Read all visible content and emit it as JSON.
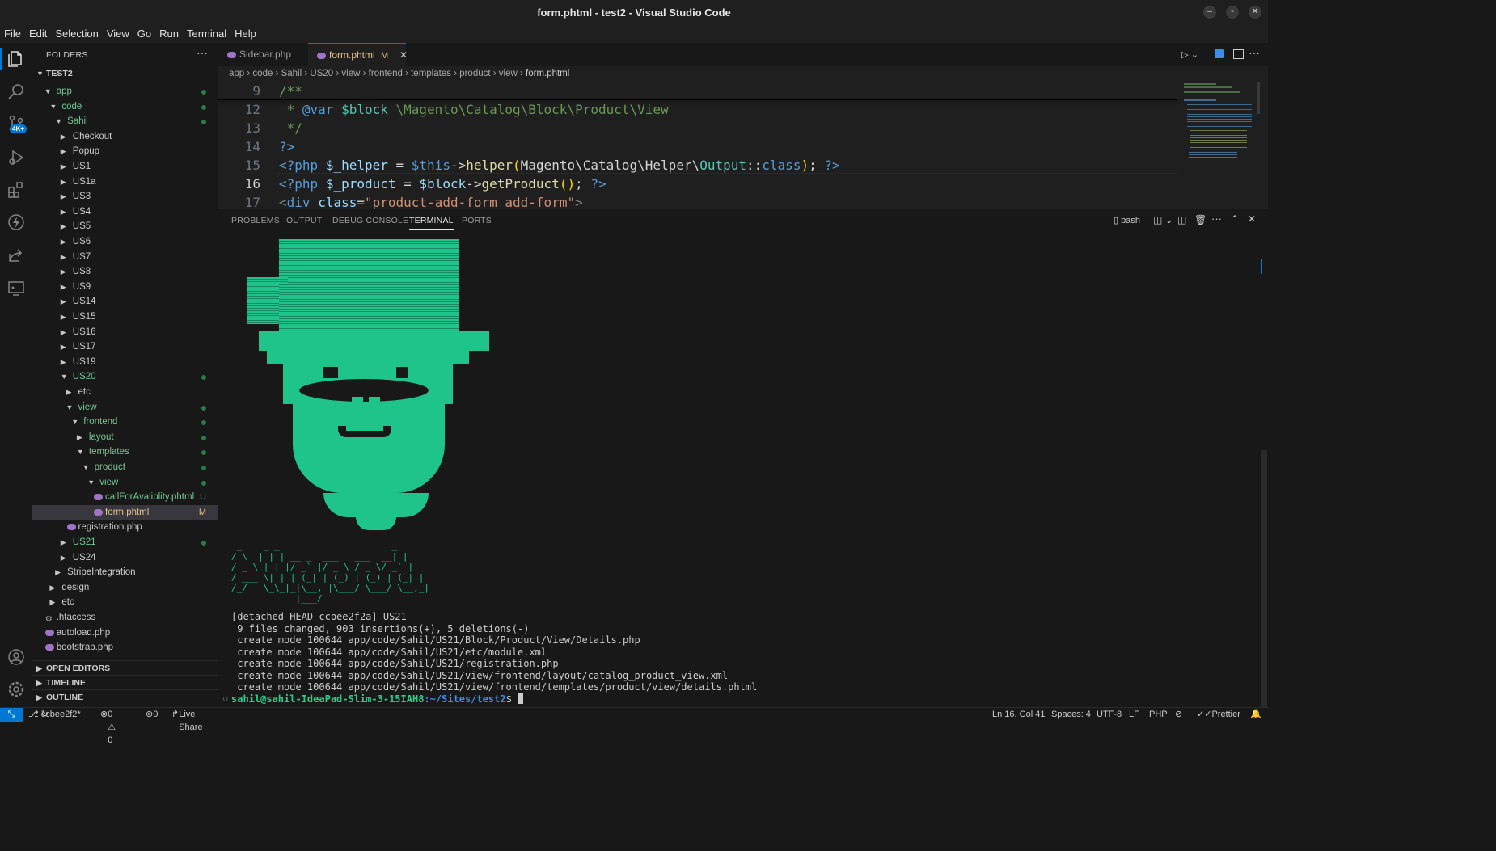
{
  "window": {
    "title": "form.phtml - test2 - Visual Studio Code"
  },
  "menu": [
    "File",
    "Edit",
    "Selection",
    "View",
    "Go",
    "Run",
    "Terminal",
    "Help"
  ],
  "sidebar": {
    "header": "FOLDERS",
    "root": "TEST2",
    "tree": [
      {
        "label": "app",
        "indent": 1,
        "type": "folder-open",
        "color": "green",
        "status": "dot"
      },
      {
        "label": "code",
        "indent": 2,
        "type": "folder-open",
        "color": "green",
        "status": "dot"
      },
      {
        "label": "Sahil",
        "indent": 3,
        "type": "folder-open",
        "color": "green",
        "status": "dot"
      },
      {
        "label": "Checkout",
        "indent": 4,
        "type": "folder",
        "color": "plain"
      },
      {
        "label": "Popup",
        "indent": 4,
        "type": "folder",
        "color": "plain"
      },
      {
        "label": "US1",
        "indent": 4,
        "type": "folder",
        "color": "plain"
      },
      {
        "label": "US1a",
        "indent": 4,
        "type": "folder",
        "color": "plain"
      },
      {
        "label": "US3",
        "indent": 4,
        "type": "folder",
        "color": "plain"
      },
      {
        "label": "US4",
        "indent": 4,
        "type": "folder",
        "color": "plain"
      },
      {
        "label": "US5",
        "indent": 4,
        "type": "folder",
        "color": "plain"
      },
      {
        "label": "US6",
        "indent": 4,
        "type": "folder",
        "color": "plain"
      },
      {
        "label": "US7",
        "indent": 4,
        "type": "folder",
        "color": "plain"
      },
      {
        "label": "US8",
        "indent": 4,
        "type": "folder",
        "color": "plain"
      },
      {
        "label": "US9",
        "indent": 4,
        "type": "folder",
        "color": "plain"
      },
      {
        "label": "US14",
        "indent": 4,
        "type": "folder",
        "color": "plain"
      },
      {
        "label": "US15",
        "indent": 4,
        "type": "folder",
        "color": "plain"
      },
      {
        "label": "US16",
        "indent": 4,
        "type": "folder",
        "color": "plain"
      },
      {
        "label": "US17",
        "indent": 4,
        "type": "folder",
        "color": "plain"
      },
      {
        "label": "US19",
        "indent": 4,
        "type": "folder",
        "color": "plain"
      },
      {
        "label": "US20",
        "indent": 4,
        "type": "folder-open",
        "color": "green",
        "status": "dot"
      },
      {
        "label": "etc",
        "indent": 5,
        "type": "folder",
        "color": "plain"
      },
      {
        "label": "view",
        "indent": 5,
        "type": "folder-open",
        "color": "green",
        "status": "dot"
      },
      {
        "label": "frontend",
        "indent": 6,
        "type": "folder-open",
        "color": "green",
        "status": "dot"
      },
      {
        "label": "layout",
        "indent": 7,
        "type": "folder",
        "color": "green",
        "status": "dot"
      },
      {
        "label": "templates",
        "indent": 7,
        "type": "folder-open",
        "color": "green",
        "status": "dot"
      },
      {
        "label": "product",
        "indent": 8,
        "type": "folder-open",
        "color": "green",
        "status": "dot"
      },
      {
        "label": "view",
        "indent": 9,
        "type": "folder-open",
        "color": "green",
        "status": "dot"
      },
      {
        "label": "callForAvaliblity.phtml",
        "indent": 10,
        "type": "php",
        "color": "green",
        "status": "U"
      },
      {
        "label": "form.phtml",
        "indent": 10,
        "type": "php",
        "color": "tan",
        "status": "M",
        "selected": true
      },
      {
        "label": "registration.php",
        "indent": 5,
        "type": "php",
        "color": "plain"
      },
      {
        "label": "US21",
        "indent": 4,
        "type": "folder",
        "color": "green",
        "status": "dot"
      },
      {
        "label": "US24",
        "indent": 4,
        "type": "folder",
        "color": "plain"
      },
      {
        "label": "StripeIntegration",
        "indent": 3,
        "type": "folder",
        "color": "plain"
      },
      {
        "label": "design",
        "indent": 2,
        "type": "folder",
        "color": "plain"
      },
      {
        "label": "etc",
        "indent": 2,
        "type": "folder",
        "color": "plain"
      },
      {
        "label": ".htaccess",
        "indent": 1,
        "type": "gear",
        "color": "plain"
      },
      {
        "label": "autoload.php",
        "indent": 1,
        "type": "php",
        "color": "plain"
      },
      {
        "label": "bootstrap.php",
        "indent": 1,
        "type": "php",
        "color": "plain"
      }
    ],
    "sections": [
      "OPEN EDITORS",
      "TIMELINE",
      "OUTLINE"
    ]
  },
  "tabs": [
    {
      "label": "Sidebar.php",
      "active": false
    },
    {
      "label": "form.phtml",
      "active": true,
      "badge": "M"
    }
  ],
  "breadcrumb": [
    "app",
    "code",
    "Sahil",
    "US20",
    "view",
    "frontend",
    "templates",
    "product",
    "view",
    "form.phtml"
  ],
  "editor": {
    "lines": [
      {
        "n": "9",
        "text": "/**"
      },
      {
        "n": "12",
        "text": " * @var $block \\Magento\\Catalog\\Block\\Product\\View"
      },
      {
        "n": "13",
        "text": " */"
      },
      {
        "n": "14",
        "text": "?>"
      },
      {
        "n": "15",
        "text": "<?php $_helper = $this->helper(Magento\\Catalog\\Helper\\Output::class); ?>"
      },
      {
        "n": "16",
        "text": "<?php $_product = $block->getProduct(); ?>"
      },
      {
        "n": "17",
        "text": "<div class=\"product-add-form add-form\">"
      }
    ]
  },
  "panel": {
    "tabs": [
      "PROBLEMS",
      "OUTPUT",
      "DEBUG CONSOLE",
      "TERMINAL",
      "PORTS"
    ],
    "active_tab": "TERMINAL",
    "shell": "bash",
    "ascii_banner": [
      " _    _ _                     _ ",
      "/ \\  | | | __ _  ___   ___  __| |",
      "/ _ \\ | | |/ _` |/ _ \\ / _ \\/ _` |",
      "/ ___ \\| | | (_| | (_) | (_) | (_| |",
      "/_/   \\_\\_|_|\\__, |\\___/ \\___/ \\__,_|",
      "            |___/                  "
    ],
    "output": [
      "[detached HEAD ccbee2f2a] US21",
      " 9 files changed, 903 insertions(+), 5 deletions(-)",
      " create mode 100644 app/code/Sahil/US21/Block/Product/View/Details.php",
      " create mode 100644 app/code/Sahil/US21/etc/module.xml",
      " create mode 100644 app/code/Sahil/US21/registration.php",
      " create mode 100644 app/code/Sahil/US21/view/frontend/layout/catalog_product_view.xml",
      " create mode 100644 app/code/Sahil/US21/view/frontend/templates/product/view/details.phtml"
    ],
    "prompt_user": "sahil@sahil-IdeaPad-Slim-3-15IAH8",
    "prompt_path": ":~/Sites/test2",
    "prompt_end": "$ "
  },
  "status": {
    "branch": "ccbee2f2*",
    "problems": "0 ⚠ 0",
    "ports": "0",
    "live_share": "Live Share",
    "position": "Ln 16, Col 41",
    "spaces": "Spaces: 4",
    "encoding": "UTF-8",
    "eol": "LF",
    "language": "PHP",
    "prettier": "Prettier"
  },
  "badge": "4K+"
}
